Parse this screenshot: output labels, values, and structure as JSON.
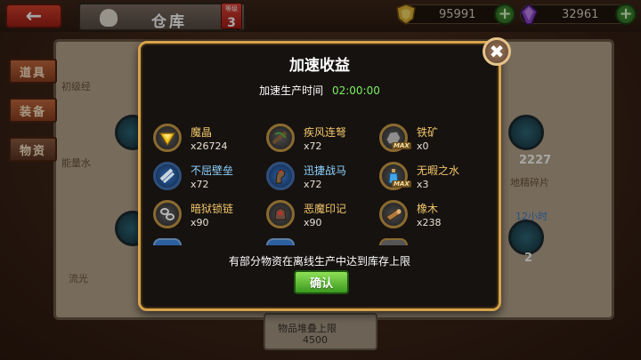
{
  "header": {
    "back_icon": "back-arrow-icon",
    "title": "仓库",
    "level_label": "等级",
    "level_value": "3"
  },
  "resources": {
    "gold_value": "95991",
    "gem_value": "32961"
  },
  "side_tabs": [
    {
      "label": "道具"
    },
    {
      "label": "装备"
    },
    {
      "label": "物资"
    }
  ],
  "background": {
    "partial_texts": [
      "初级经",
      "能量水",
      "流光",
      "地精碎片",
      "2227",
      "2",
      "12小时"
    ],
    "bottom_plate": {
      "label": "物品堆叠上限",
      "value": "4500"
    }
  },
  "modal": {
    "title": "加速收益",
    "time_label": "加速生产时间",
    "time_value": "02:00:00",
    "items": [
      {
        "name": "魔晶",
        "count": "x26724",
        "icon": "gold-crystal-icon",
        "max": false
      },
      {
        "name": "疾风连弩",
        "count": "x72",
        "icon": "crossbow-icon",
        "max": false
      },
      {
        "name": "铁矿",
        "count": "x0",
        "icon": "iron-ore-icon",
        "max": true
      },
      {
        "name": "不屈壁垒",
        "count": "x72",
        "icon": "shield-wall-icon",
        "max": false
      },
      {
        "name": "迅捷战马",
        "count": "x72",
        "icon": "warhorse-icon",
        "max": false
      },
      {
        "name": "无暇之水",
        "count": "x3",
        "icon": "water-bottle-icon",
        "max": true
      },
      {
        "name": "暗狱锁链",
        "count": "x90",
        "icon": "chain-icon",
        "max": false
      },
      {
        "name": "恶魔印记",
        "count": "x90",
        "icon": "demon-mark-icon",
        "max": false
      },
      {
        "name": "橡木",
        "count": "x238",
        "icon": "oak-wood-icon",
        "max": false
      }
    ],
    "max_tag": "MAX",
    "notice": "有部分物资在离线生产中达到库存上限",
    "confirm_label": "确认",
    "close_icon": "close-icon"
  },
  "colors": {
    "accent_gold": "#d7a24a",
    "item_name_gold": "#f2c66a",
    "item_name_blue": "#8fd4ff",
    "time_green": "#7df061",
    "confirm_green": "#5cc23a"
  }
}
